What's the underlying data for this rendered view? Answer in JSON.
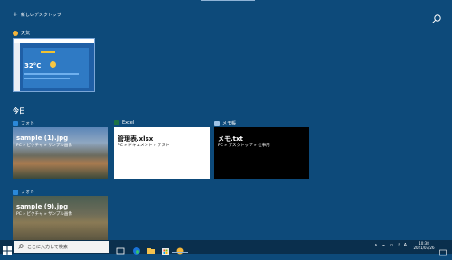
{
  "topbar": {
    "new_desktop_label": "新しいデスクトップ"
  },
  "weather": {
    "app_label": "天気",
    "temperature": "32°C"
  },
  "section": {
    "today_label": "今日"
  },
  "cards": [
    {
      "app": "フォト",
      "title": "sample (1).jpg",
      "path": "PC » ピクチャ » サンプル画像"
    },
    {
      "app": "Excel",
      "title": "管理表.xlsx",
      "path": "PC » ドキュメント » テスト"
    },
    {
      "app": "メモ帳",
      "title": "メモ.txt",
      "path": "PC » デスクトップ » 仕事用"
    },
    {
      "app": "フォト",
      "title": "sample (9).jpg",
      "path": "PC » ピクチャ » サンプル画像"
    }
  ],
  "taskbar": {
    "search_placeholder": "ここに入力して検索",
    "time": "10:38",
    "date": "2021/07/26"
  },
  "colors": {
    "background": "#0d4a7a",
    "taskbar": "#0a2f4d",
    "excel_green": "#1e7145",
    "accent_blue": "#1a73d9"
  }
}
